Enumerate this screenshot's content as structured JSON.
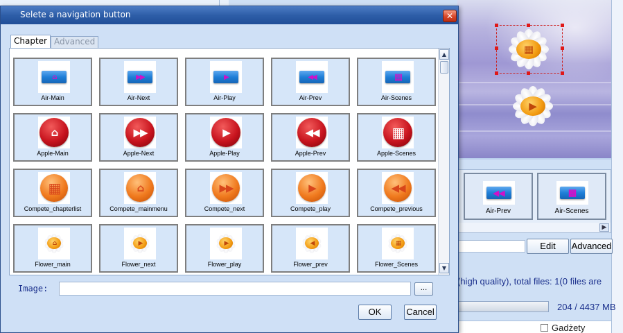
{
  "dialog": {
    "title": "Selete a navigation button",
    "close_glyph": "✕",
    "tabs": [
      {
        "label": "Chapter",
        "active": true
      },
      {
        "label": "Advanced",
        "active": false
      }
    ],
    "items": [
      {
        "label": "Air-Main",
        "style": "air",
        "glyph": "⌂"
      },
      {
        "label": "Air-Next",
        "style": "air",
        "glyph": "▶▶"
      },
      {
        "label": "Air-Play",
        "style": "air",
        "glyph": "▶"
      },
      {
        "label": "Air-Prev",
        "style": "air",
        "glyph": "◀◀"
      },
      {
        "label": "Air-Scenes",
        "style": "air",
        "glyph": "▦"
      },
      {
        "label": "Apple-Main",
        "style": "apple",
        "glyph": "⌂"
      },
      {
        "label": "Apple-Next",
        "style": "apple",
        "glyph": "▶▶"
      },
      {
        "label": "Apple-Play",
        "style": "apple",
        "glyph": "▶"
      },
      {
        "label": "Apple-Prev",
        "style": "apple",
        "glyph": "◀◀"
      },
      {
        "label": "Apple-Scenes",
        "style": "apple",
        "glyph": "▦"
      },
      {
        "label": "Compete_chapterlist",
        "style": "compete",
        "glyph": "▦"
      },
      {
        "label": "Compete_mainmenu",
        "style": "compete",
        "glyph": "⌂"
      },
      {
        "label": "Compete_next",
        "style": "compete",
        "glyph": "▶▶"
      },
      {
        "label": "Compete_play",
        "style": "compete",
        "glyph": "▶"
      },
      {
        "label": "Compete_previous",
        "style": "compete",
        "glyph": "◀◀"
      },
      {
        "label": "Flower_main",
        "style": "flower",
        "glyph": "⌂"
      },
      {
        "label": "Flower_next",
        "style": "flower",
        "glyph": "▶"
      },
      {
        "label": "Flower_play",
        "style": "flower",
        "glyph": "▶"
      },
      {
        "label": "Flower_prev",
        "style": "flower",
        "glyph": "◀"
      },
      {
        "label": "Flower_Scenes",
        "style": "flower",
        "glyph": "▦"
      }
    ],
    "image_label": "Image:",
    "image_value": "",
    "browse_label": "...",
    "ok_label": "OK",
    "cancel_label": "Cancel"
  },
  "background": {
    "thumbnails": [
      {
        "label": "Air-Prev",
        "glyph": "◀◀"
      },
      {
        "label": "Air-Scenes",
        "glyph": "▦"
      }
    ],
    "edit_label": "Edit",
    "advanced_label": "Advanced",
    "info_text": "(high quality), total files: 1(0 files are",
    "size_text": "204 / 4437 MB",
    "progress_fraction": 0.04,
    "tree_item": "Gadżety"
  },
  "colors": {
    "air_glyph": "#d010c8",
    "apple_glyph": "#ffffff",
    "compete_glyph": "#d8461a",
    "flower_glyph": "#c0480a",
    "titlebar": "#2e5ea8",
    "cell_border": "#7e7e7e"
  }
}
